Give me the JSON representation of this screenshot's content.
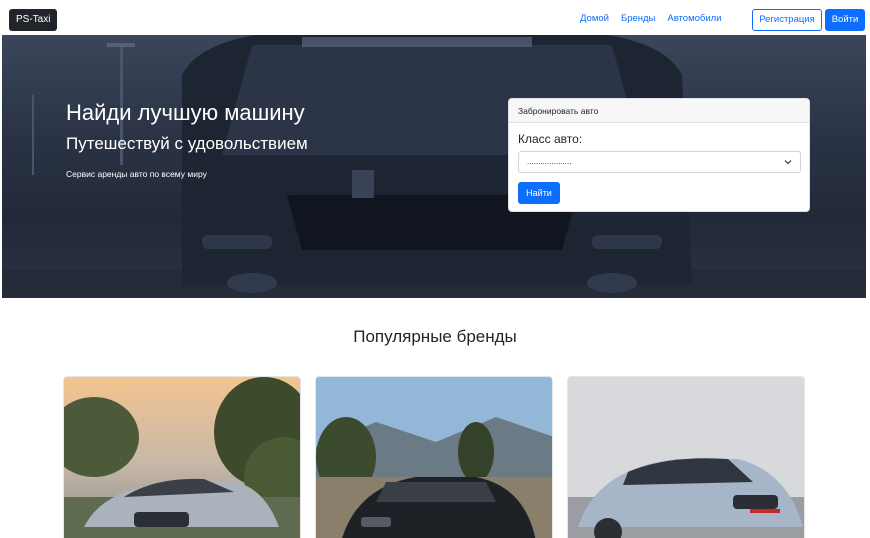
{
  "navbar": {
    "brand": "PS-Taxi",
    "links": [
      "Домой",
      "Бренды",
      "Автомобили"
    ],
    "register_label": "Регистрация",
    "login_label": "Войти"
  },
  "hero": {
    "title": "Найди лучшую машину",
    "subtitle": "Путешествуй с удовольствием",
    "description": "Сервис аренды авто по всему миру"
  },
  "booking": {
    "header": "Забронировать авто",
    "label": "Класс авто:",
    "select_value": "....................",
    "submit_label": "Найти"
  },
  "brands_section": {
    "title": "Популярные бренды"
  },
  "colors": {
    "primary": "#0d6efd",
    "dark": "#212529"
  }
}
